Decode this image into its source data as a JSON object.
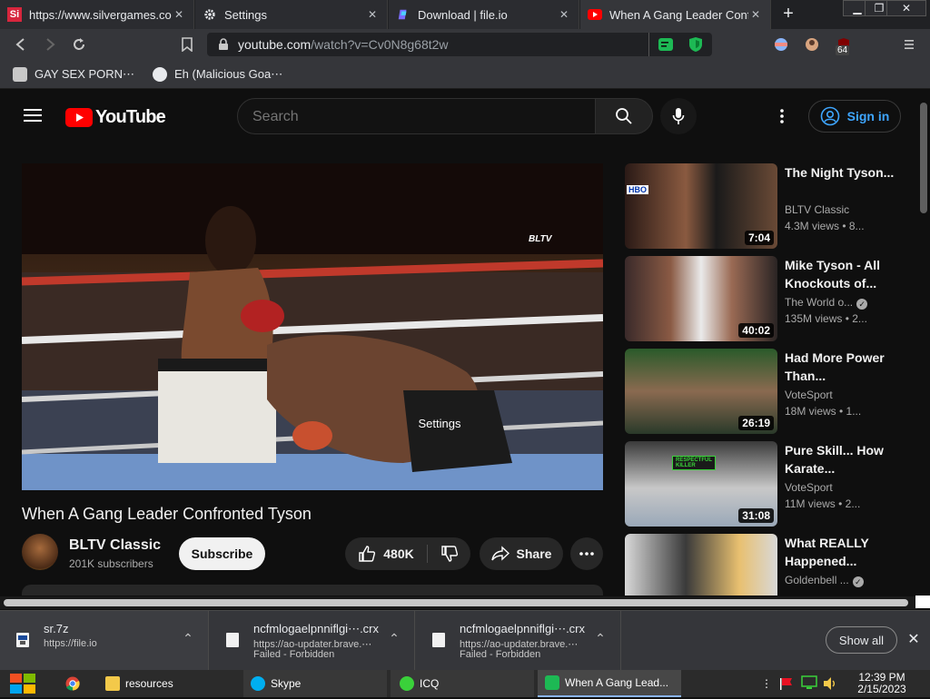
{
  "browser": {
    "tabs": [
      {
        "label": "https://www.silvergames.co",
        "favicon": "silvergames-icon",
        "active": false
      },
      {
        "label": "Settings",
        "favicon": "gear-icon",
        "active": false
      },
      {
        "label": "Download | file.io",
        "favicon": "fileio-icon",
        "active": false
      },
      {
        "label": "When A Gang Leader Confr",
        "favicon": "youtube-icon",
        "active": true
      }
    ],
    "new_tab": "+",
    "url_host": "youtube.com",
    "url_path": "/watch?v=Cv0N8g68t2w",
    "extension_badge": "64",
    "bookmarks": [
      {
        "label": "GAY SEX PORN⋯"
      },
      {
        "label": "Eh (Malicious Goa⋯"
      }
    ]
  },
  "youtube": {
    "logo": "YouTube",
    "search_placeholder": "Search",
    "sign_in": "Sign in",
    "video": {
      "watermark": "BLTV",
      "settings_tooltip": "Settings",
      "title": "When A Gang Leader Confronted Tyson",
      "channel": "BLTV Classic",
      "subscribers": "201K subscribers",
      "subscribe": "Subscribe",
      "likes": "480K",
      "share": "Share"
    },
    "recommendations": [
      {
        "title": "The Night Tyson...",
        "channel": "BLTV Classic",
        "meta": "4.3M views • 8...",
        "duration": "7:04",
        "verified": false
      },
      {
        "title": "Mike Tyson - All Knockouts of...",
        "channel": "The World o...",
        "meta": "135M views • 2...",
        "duration": "40:02",
        "verified": true
      },
      {
        "title": "Had More Power Than...",
        "channel": "VoteSport",
        "meta": "18M views • 1...",
        "duration": "26:19",
        "verified": false
      },
      {
        "title": "Pure Skill... How Karate...",
        "channel": "VoteSport",
        "meta": "11M views • 2...",
        "duration": "31:08",
        "verified": false
      },
      {
        "title": "What REALLY Happened...",
        "channel": "Goldenbell ...",
        "meta": "",
        "duration": "",
        "verified": true
      }
    ]
  },
  "downloads": {
    "items": [
      {
        "name": "sr.7z",
        "source": "https://file.io",
        "status": ""
      },
      {
        "name": "ncfmlogaelpnniflgi⋯.crx",
        "source": "https://ao-updater.brave.⋯",
        "status": "Failed - Forbidden"
      },
      {
        "name": "ncfmlogaelpnniflgi⋯.crx",
        "source": "https://ao-updater.brave.⋯",
        "status": "Failed - Forbidden"
      }
    ],
    "show_all": "Show all"
  },
  "taskbar": {
    "items": [
      {
        "label": "resources",
        "icon": "folder-icon"
      },
      {
        "label": "Skype",
        "icon": "skype-icon"
      },
      {
        "label": "ICQ",
        "icon": "icq-icon"
      },
      {
        "label": "When A Gang Lead...",
        "icon": "browser-icon"
      }
    ],
    "time": "12:39 PM",
    "date": "2/15/2023"
  },
  "colors": {
    "youtube_red": "#ff0000",
    "link_blue": "#3ea6ff",
    "brave_green": "#1db954"
  }
}
